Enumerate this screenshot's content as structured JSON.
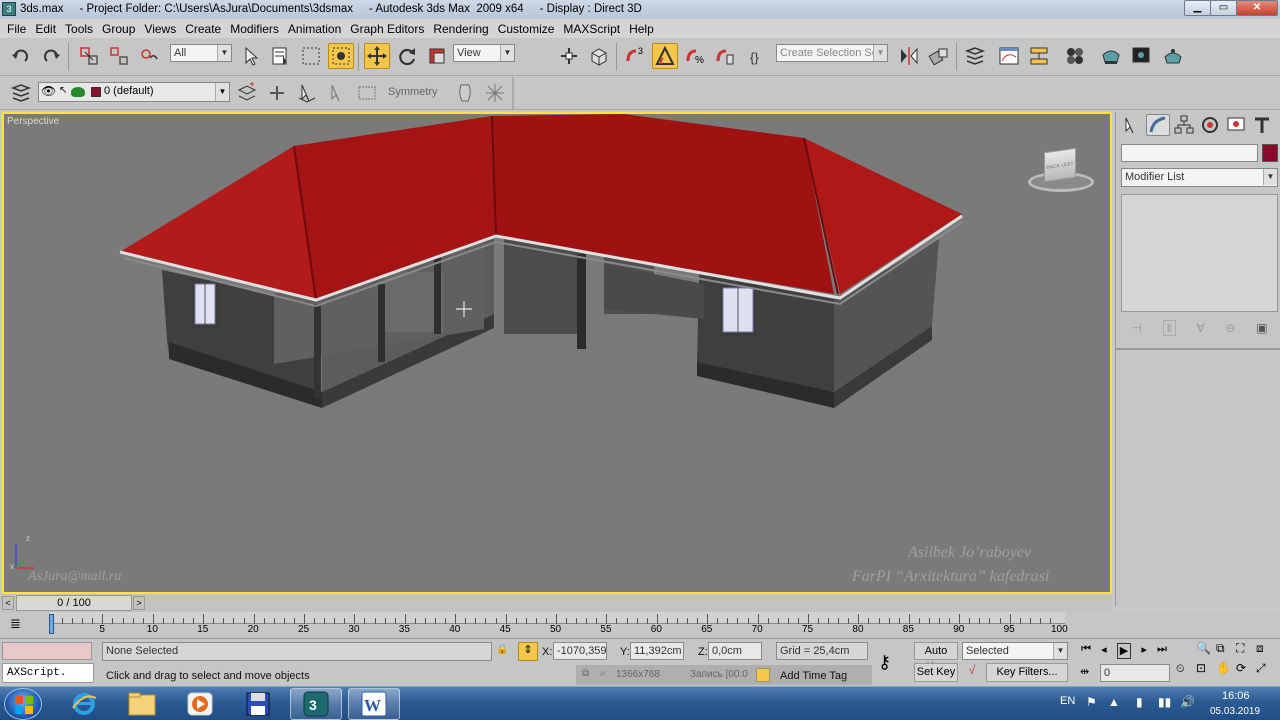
{
  "window": {
    "title": "3ds.max     - Project Folder: C:\\Users\\AsJura\\Documents\\3dsmax     - Autodesk 3ds Max  2009 x64     - Display : Direct 3D",
    "icon_text": "3",
    "min_label": "▁",
    "max_label": "▭",
    "close_label": "✕"
  },
  "menu": [
    "File",
    "Edit",
    "Tools",
    "Group",
    "Views",
    "Create",
    "Modifiers",
    "Animation",
    "Graph Editors",
    "Rendering",
    "Customize",
    "MAXScript",
    "Help"
  ],
  "toolbar": {
    "selection_filter": "All",
    "ref_coord": "View",
    "named_selection_placeholder": "Create Selection Set",
    "snap_number": "3"
  },
  "layer_bar": {
    "layer_name": "0 (default)",
    "symmetry_label": "Symmetry"
  },
  "viewport": {
    "label": "Perspective",
    "watermark_email": "AsJura@mail.ru",
    "watermark_author": "Asilbek Jo’raboyev",
    "watermark_dept": "FarPI “Arxitektura” kafedrasi",
    "axis_z": "z",
    "axis_x": "x",
    "viewcube_text": "BACK LEFT",
    "colors": {
      "roof": "#a51414",
      "walls": "#4a4a4a",
      "border": "#ffe23a"
    }
  },
  "command_panel": {
    "modifier_list": "Modifier List",
    "color_swatch": "#8a0a2a"
  },
  "time": {
    "slider_label": "0 / 100",
    "ticks": [
      "0",
      "5",
      "10",
      "15",
      "20",
      "25",
      "30",
      "35",
      "40",
      "45",
      "50",
      "55",
      "60",
      "65",
      "70",
      "75",
      "80",
      "85",
      "90",
      "95",
      "100"
    ]
  },
  "status": {
    "maxscript": "AXScript.",
    "selection": "None Selected",
    "prompt": "Click and drag to select and move objects",
    "x_label": "X:",
    "x_value": "-1070,359c",
    "y_label": "Y:",
    "y_value": "11,392cm",
    "z_label": "Z:",
    "z_value": "0,0cm",
    "grid": "Grid = 25,4cm",
    "auto_key": "Auto Key",
    "set_key": "Set Key",
    "key_mode": "Selected",
    "key_filters": "Key Filters...",
    "frame": "0",
    "add_time_tag": "Add Time Tag",
    "recording_overlay": "1366x768",
    "recording_label": "Запись [00:0"
  },
  "taskbar": {
    "lang": "EN",
    "time": "16:06",
    "date": "05.03.2019"
  }
}
